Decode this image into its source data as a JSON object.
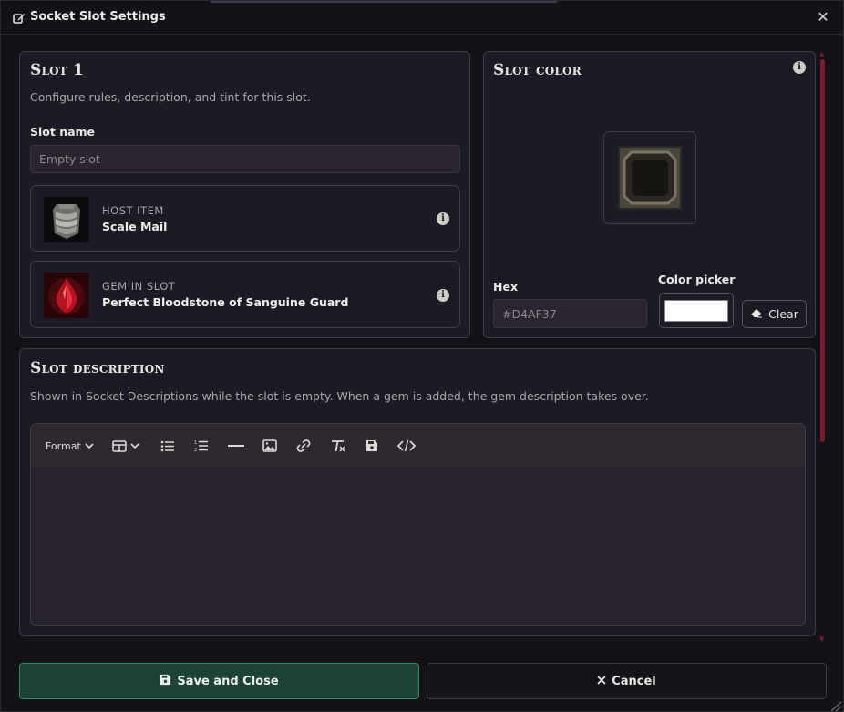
{
  "window": {
    "title": "Socket Slot Settings",
    "close_glyph": "✕"
  },
  "slot": {
    "heading": "Slot 1",
    "description": "Configure rules, description, and tint for this slot.",
    "name_label": "Slot name",
    "name_placeholder": "Empty slot"
  },
  "host_item": {
    "kicker": "HOST ITEM",
    "name": "Scale Mail",
    "icon": "scale-mail-icon"
  },
  "gem": {
    "kicker": "GEM IN SLOT",
    "name": "Perfect Bloodstone of Sanguine Guard",
    "icon": "bloodstone-gem-icon"
  },
  "slot_color": {
    "heading": "Slot color",
    "hex_label": "Hex",
    "hex_placeholder": "#D4AF37",
    "picker_label": "Color picker",
    "picker_value": "#FFFFFF",
    "clear_label": "Clear"
  },
  "slot_description": {
    "heading": "Slot description",
    "help": "Shown in Socket Descriptions while the slot is empty. When a gem is added, the gem description takes over.",
    "toolbar": {
      "format_label": "Format",
      "tools": [
        "format-dropdown",
        "table-icon",
        "bullet-list-icon",
        "numbered-list-icon",
        "horizontal-rule-icon",
        "image-icon",
        "link-icon",
        "clear-format-icon",
        "save-icon",
        "source-code-icon"
      ]
    },
    "body": ""
  },
  "footer": {
    "save_label": "Save and Close",
    "cancel_label": "Cancel"
  },
  "colors": {
    "accent_green": "#1D4336",
    "scrollbar": "#7A1A2B",
    "panel": "#1B1B26"
  }
}
